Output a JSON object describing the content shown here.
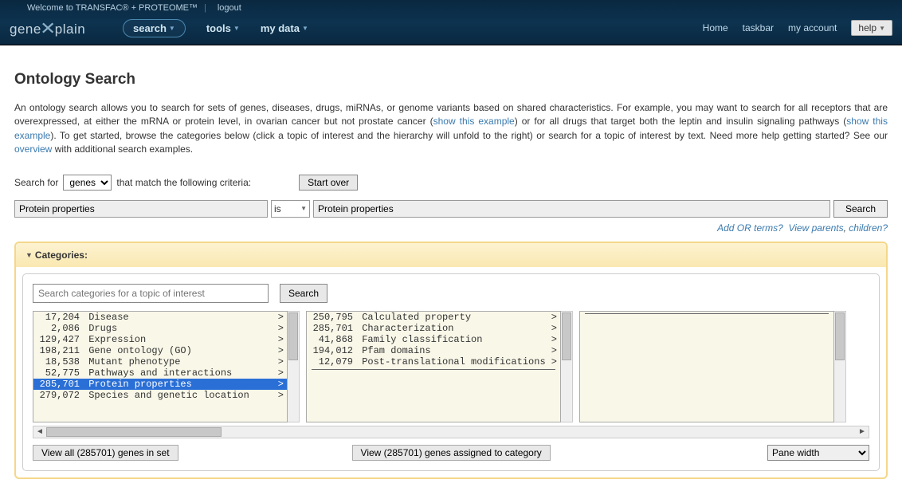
{
  "header": {
    "welcome": "Welcome to TRANSFAC® + PROTEOME™",
    "logout": "logout",
    "logo_left": "gene",
    "logo_right": "plain",
    "nav": {
      "search": "search",
      "tools": "tools",
      "mydata": "my data"
    },
    "right": {
      "home": "Home",
      "taskbar": "taskbar",
      "myaccount": "my account",
      "help": "help"
    }
  },
  "page": {
    "title": "Ontology Search",
    "intro_1": "An ontology search allows you to search for sets of genes, diseases, drugs, miRNAs, or genome variants based on shared characteristics. For example, you may want to search for all receptors that are overexpressed, at either the mRNA or protein level, in ovarian cancer but not prostate cancer (",
    "link1": "show this example",
    "intro_2": ") or for all drugs that target both the leptin and insulin signaling pathways (",
    "link2": "show this example",
    "intro_3": "). To get started, browse the categories below (click a topic of interest and the hierarchy will unfold to the right) or search for a topic of interest by text. Need more help getting started? See our ",
    "link3": "overview",
    "intro_4": " with additional search examples."
  },
  "criteria": {
    "searchfor_label": "Search for",
    "searchfor_value": "genes",
    "match_label": "that match the following criteria:",
    "startover": "Start over"
  },
  "filter": {
    "field1": "Protein properties",
    "op": "is",
    "field3": "Protein properties",
    "search_btn": "Search"
  },
  "hints": {
    "add_or": "Add OR terms?",
    "view_parents": "View parents",
    "children": "children?"
  },
  "categories": {
    "header": "Categories:",
    "search_placeholder": "Search categories for a topic of interest",
    "search_btn": "Search",
    "pane1": [
      {
        "count": "17,204",
        "label": "Disease",
        "sel": false
      },
      {
        "count": "2,086",
        "label": "Drugs",
        "sel": false
      },
      {
        "count": "129,427",
        "label": "Expression",
        "sel": false
      },
      {
        "count": "198,211",
        "label": "Gene ontology (GO)",
        "sel": false
      },
      {
        "count": "18,538",
        "label": "Mutant phenotype",
        "sel": false
      },
      {
        "count": "52,775",
        "label": "Pathways and interactions",
        "sel": false
      },
      {
        "count": "285,701",
        "label": "Protein properties",
        "sel": true
      },
      {
        "count": "279,072",
        "label": "Species and genetic location",
        "sel": false
      }
    ],
    "pane2": [
      {
        "count": "250,795",
        "label": "Calculated property",
        "sel": false
      },
      {
        "count": "285,701",
        "label": "Characterization",
        "sel": false
      },
      {
        "count": "41,868",
        "label": "Family classification",
        "sel": false
      },
      {
        "count": "194,012",
        "label": "Pfam domains",
        "sel": false
      },
      {
        "count": "12,079",
        "label": "Post-translational modifications",
        "sel": false
      }
    ],
    "viewall": "View all (285701) genes in set",
    "viewassigned": "View (285701) genes assigned to category",
    "panewidth": "Pane width"
  }
}
